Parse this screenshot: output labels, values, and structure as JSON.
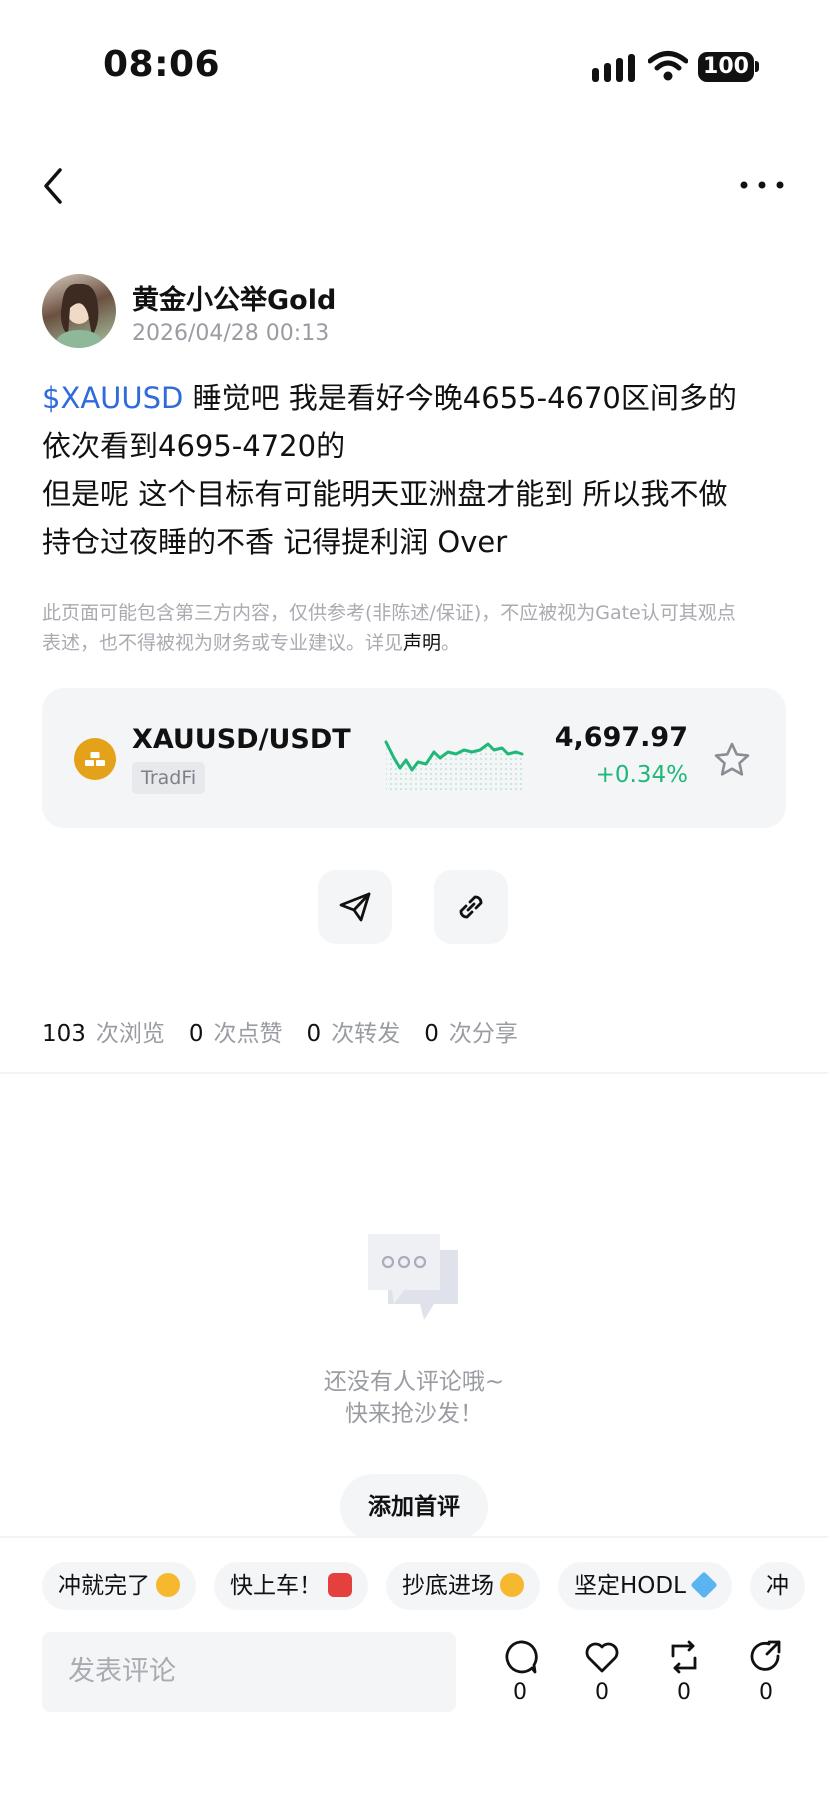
{
  "status_bar": {
    "time": "08:06",
    "battery": "100"
  },
  "author": {
    "name": "黄金小公举Gold",
    "timestamp": "2026/04/28 00:13"
  },
  "post": {
    "ticker": "$XAUUSD",
    "line1_rest": " 睡觉吧 我是看好今晚4655-4670区间多的",
    "line2": "依次看到4695-4720的",
    "line3": "但是呢 这个目标有可能明天亚洲盘才能到 所以我不做",
    "line4": "持仓过夜睡的不香 记得提利润 Over"
  },
  "disclaimer": {
    "text1": "此页面可能包含第三方内容，仅供参考(非陈述/保证)，不应被视为Gate认可其观点",
    "text2": "表述，也不得被视为财务或专业建议。详见",
    "statement_link": "声明",
    "end": "。"
  },
  "asset_card": {
    "pair": "XAUUSD/USDT",
    "tag": "TradFi",
    "price": "4,697.97",
    "change": "+0.34%",
    "colors": {
      "up": "#1fb879",
      "coin": "#e3a21a"
    }
  },
  "stats": {
    "views_num": "103",
    "views_label": "次浏览",
    "likes_num": "0",
    "likes_label": "次点赞",
    "reposts_num": "0",
    "reposts_label": "次转发",
    "shares_num": "0",
    "shares_label": "次分享"
  },
  "empty_state": {
    "line1": "还没有人评论哦~",
    "line2": "快来抢沙发！",
    "button": "添加首评"
  },
  "quick_replies": [
    {
      "label": "冲就完了",
      "emoji_color": "#f5b82e"
    },
    {
      "label": "快上车！",
      "emoji_color": "#e4403d"
    },
    {
      "label": "抄底进场",
      "emoji_color": "#f5b82e"
    },
    {
      "label": "坚定HODL",
      "emoji_color": "#5ab4f0"
    },
    {
      "label": "冲",
      "emoji_color": ""
    }
  ],
  "composer": {
    "placeholder": "发表评论"
  },
  "actions": {
    "comment": "0",
    "like": "0",
    "repost": "0",
    "share": "0"
  }
}
